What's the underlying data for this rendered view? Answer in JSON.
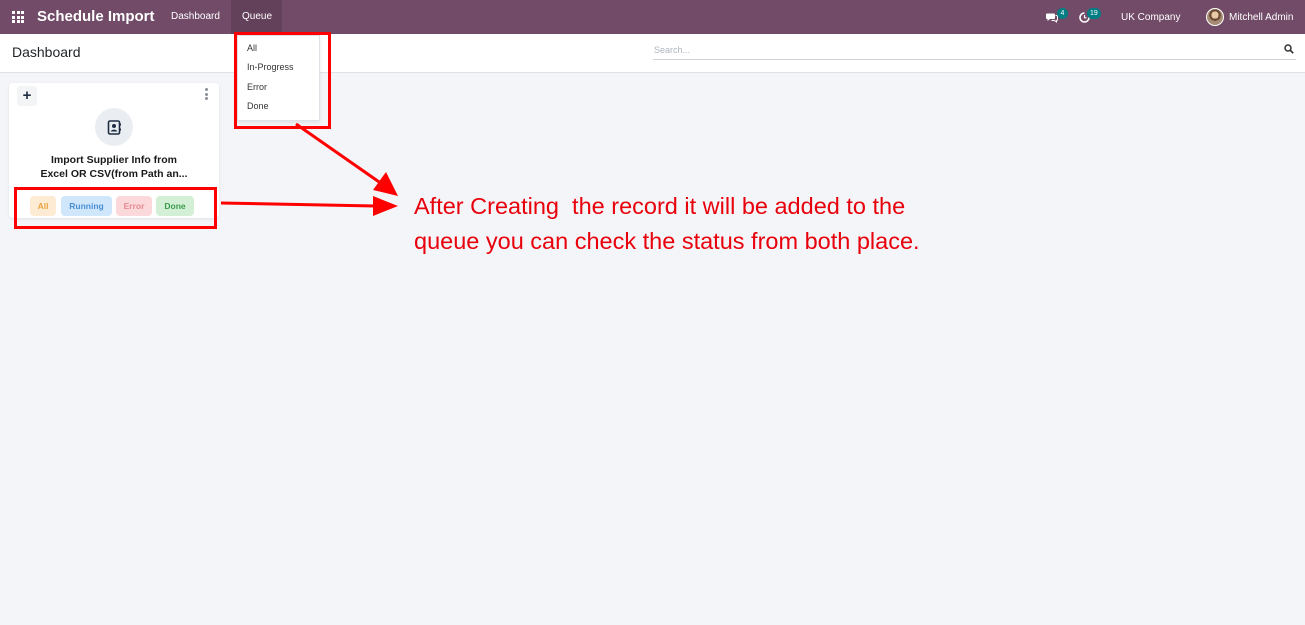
{
  "navbar": {
    "apps_icon": "apps-grid-icon",
    "brand": "Schedule Import",
    "menus": [
      {
        "label": "Dashboard",
        "active": false
      },
      {
        "label": "Queue",
        "active": true
      }
    ],
    "messages_icon": "chat-icon",
    "messages_count": "4",
    "activity_icon": "clock-icon",
    "activity_count": "19",
    "company": "UK Company",
    "user_name": "Mitchell Admin",
    "color": "#714b67"
  },
  "control_panel": {
    "title": "Dashboard",
    "search_placeholder": "Search...",
    "search_icon": "search-icon"
  },
  "queue_dropdown": {
    "items": [
      {
        "label": "All"
      },
      {
        "label": "In-Progress"
      },
      {
        "label": "Error"
      },
      {
        "label": "Done"
      }
    ]
  },
  "card": {
    "add_label": "+",
    "icon": "contact-book-icon",
    "title_line1": "Import Supplier Info from",
    "title_line2": "Excel OR CSV(from Path an...",
    "buttons": [
      {
        "label": "All",
        "bg": "#fdebd4",
        "fg": "#e8a33d"
      },
      {
        "label": "Running",
        "bg": "#cfe6fb",
        "fg": "#4a8fd6"
      },
      {
        "label": "Error",
        "bg": "#fbd8da",
        "fg": "#e78a91"
      },
      {
        "label": "Done",
        "bg": "#d3f0d6",
        "fg": "#3c9a4b"
      }
    ]
  },
  "annotation": {
    "line1": "After Creating  the record it will be added to the",
    "line2": "queue you can check the status from both place.",
    "color": "#ff0000"
  }
}
